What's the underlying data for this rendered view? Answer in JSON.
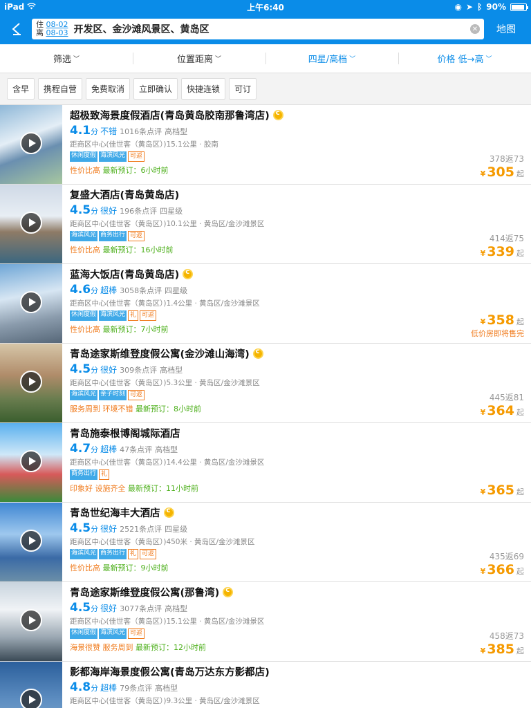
{
  "status": {
    "device": "iPad",
    "time": "上午6:40",
    "battery": "90%"
  },
  "nav": {
    "checkin_label": "住",
    "checkin": "08-02",
    "checkout_label": "离",
    "checkout": "08-03",
    "query": "开发区、金沙滩风景区、黄岛区",
    "map": "地图"
  },
  "filters": [
    {
      "label": "筛选",
      "active": false
    },
    {
      "label": "位置距离",
      "active": false
    },
    {
      "label": "四星/高档",
      "active": true
    },
    {
      "label": "价格 低→高",
      "active": true
    }
  ],
  "chips": [
    "含早",
    "携程自营",
    "免费取消",
    "立即确认",
    "快捷连锁",
    "可订"
  ],
  "hotels": [
    {
      "name": "超极致海景度假酒店(青岛黄岛胶南那鲁湾店)",
      "coin": true,
      "score": "4.1",
      "fen": "分",
      "level": "不错",
      "reviews": "1016条点评",
      "type": "高档型",
      "addr": "距商区中心(佳世客（黄岛区）)15.1公里 · 胶南",
      "tags": [
        "休闲度假",
        "海滨风光"
      ],
      "otags": [
        "可返"
      ],
      "promo_h": "性价比高",
      "promo_n": "最新预订：6小时前",
      "orig": "378返73",
      "yen": "¥",
      "price": "305",
      "qi": "起",
      "warn": ""
    },
    {
      "name": "复盛大酒店(青岛黄岛店)",
      "coin": false,
      "score": "4.5",
      "fen": "分",
      "level": "很好",
      "reviews": "196条点评",
      "type": "四星级",
      "addr": "距商区中心(佳世客（黄岛区）)10.1公里 · 黄岛区/金沙滩景区",
      "tags": [
        "海滨风光",
        "商务出行"
      ],
      "otags": [
        "可返"
      ],
      "promo_h": "性价比高",
      "promo_n": "最新预订：16小时前",
      "orig": "414返75",
      "yen": "¥",
      "price": "339",
      "qi": "起",
      "warn": ""
    },
    {
      "name": "蓝海大饭店(青岛黄岛店)",
      "coin": true,
      "score": "4.6",
      "fen": "分",
      "level": "超棒",
      "reviews": "3058条点评",
      "type": "四星级",
      "addr": "距商区中心(佳世客（黄岛区）)1.4公里 · 黄岛区/金沙滩景区",
      "tags": [
        "休闲度假",
        "海滨风光"
      ],
      "otags": [
        "礼",
        "可返"
      ],
      "promo_h": "性价比高",
      "promo_n": "最新预订：7小时前",
      "orig": "",
      "yen": "¥",
      "price": "358",
      "qi": "起",
      "warn": "低价房即将售完"
    },
    {
      "name": "青岛途家斯维登度假公寓(金沙滩山海湾)",
      "coin": true,
      "score": "4.5",
      "fen": "分",
      "level": "很好",
      "reviews": "309条点评",
      "type": "高档型",
      "addr": "距商区中心(佳世客（黄岛区）)5.3公里 · 黄岛区/金沙滩景区",
      "tags": [
        "海滨风光",
        "亲子时刻"
      ],
      "otags": [
        "可返"
      ],
      "promo_h": "服务周到 环境不错",
      "promo_n": "最新预订：8小时前",
      "orig": "445返81",
      "yen": "¥",
      "price": "364",
      "qi": "起",
      "warn": ""
    },
    {
      "name": "青岛施泰根博阁城际酒店",
      "coin": false,
      "score": "4.7",
      "fen": "分",
      "level": "超棒",
      "reviews": "47条点评",
      "type": "高档型",
      "addr": "距商区中心(佳世客（黄岛区）)14.4公里 · 黄岛区/金沙滩景区",
      "tags": [
        "商务出行"
      ],
      "otags": [
        "礼"
      ],
      "promo_h": "印象好 设施齐全",
      "promo_n": "最新预订：11小时前",
      "orig": "",
      "yen": "¥",
      "price": "365",
      "qi": "起",
      "warn": ""
    },
    {
      "name": "青岛世纪海丰大酒店",
      "coin": true,
      "score": "4.5",
      "fen": "分",
      "level": "很好",
      "reviews": "2521条点评",
      "type": "四星级",
      "addr": "距商区中心(佳世客（黄岛区）)450米 · 黄岛区/金沙滩景区",
      "tags": [
        "海滨风光",
        "商务出行"
      ],
      "otags": [
        "礼",
        "可返"
      ],
      "promo_h": "性价比高",
      "promo_n": "最新预订：9小时前",
      "orig": "435返69",
      "yen": "¥",
      "price": "366",
      "qi": "起",
      "warn": ""
    },
    {
      "name": "青岛途家斯维登度假公寓(那鲁湾)",
      "coin": true,
      "score": "4.5",
      "fen": "分",
      "level": "很好",
      "reviews": "3077条点评",
      "type": "高档型",
      "addr": "距商区中心(佳世客（黄岛区）)15.1公里 · 黄岛区/金沙滩景区",
      "tags": [
        "休闲度假",
        "海滨风光"
      ],
      "otags": [
        "可返"
      ],
      "promo_h": "海景很赞 服务周到",
      "promo_n": "最新预订：12小时前",
      "orig": "458返73",
      "yen": "¥",
      "price": "385",
      "qi": "起",
      "warn": ""
    },
    {
      "name": "影都海岸海景度假公寓(青岛万达东方影都店)",
      "coin": false,
      "score": "4.8",
      "fen": "分",
      "level": "超棒",
      "reviews": "79条点评",
      "type": "高档型",
      "addr": "距商区中心(佳世客（黄岛区）)9.3公里 · 黄岛区/金沙滩景区",
      "tags": [],
      "otags": [],
      "promo_h": "",
      "promo_n": "",
      "orig": "",
      "yen": "",
      "price": "",
      "qi": "",
      "warn": ""
    }
  ]
}
